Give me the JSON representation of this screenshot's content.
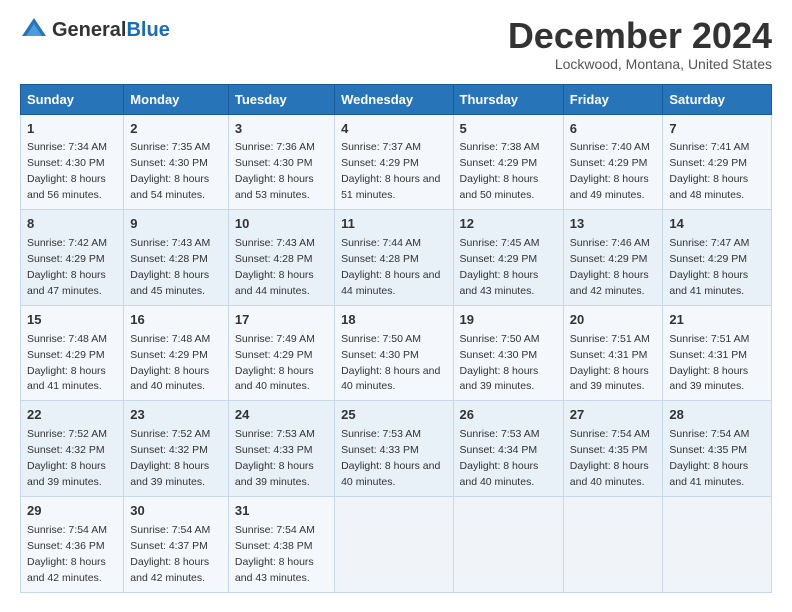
{
  "logo": {
    "general": "General",
    "blue": "Blue"
  },
  "title": "December 2024",
  "subtitle": "Lockwood, Montana, United States",
  "header": {
    "days": [
      "Sunday",
      "Monday",
      "Tuesday",
      "Wednesday",
      "Thursday",
      "Friday",
      "Saturday"
    ]
  },
  "weeks": [
    [
      {
        "day": "1",
        "sunrise": "7:34 AM",
        "sunset": "4:30 PM",
        "daylight": "8 hours and 56 minutes."
      },
      {
        "day": "2",
        "sunrise": "7:35 AM",
        "sunset": "4:30 PM",
        "daylight": "8 hours and 54 minutes."
      },
      {
        "day": "3",
        "sunrise": "7:36 AM",
        "sunset": "4:30 PM",
        "daylight": "8 hours and 53 minutes."
      },
      {
        "day": "4",
        "sunrise": "7:37 AM",
        "sunset": "4:29 PM",
        "daylight": "8 hours and 51 minutes."
      },
      {
        "day": "5",
        "sunrise": "7:38 AM",
        "sunset": "4:29 PM",
        "daylight": "8 hours and 50 minutes."
      },
      {
        "day": "6",
        "sunrise": "7:40 AM",
        "sunset": "4:29 PM",
        "daylight": "8 hours and 49 minutes."
      },
      {
        "day": "7",
        "sunrise": "7:41 AM",
        "sunset": "4:29 PM",
        "daylight": "8 hours and 48 minutes."
      }
    ],
    [
      {
        "day": "8",
        "sunrise": "7:42 AM",
        "sunset": "4:29 PM",
        "daylight": "8 hours and 47 minutes."
      },
      {
        "day": "9",
        "sunrise": "7:43 AM",
        "sunset": "4:28 PM",
        "daylight": "8 hours and 45 minutes."
      },
      {
        "day": "10",
        "sunrise": "7:43 AM",
        "sunset": "4:28 PM",
        "daylight": "8 hours and 44 minutes."
      },
      {
        "day": "11",
        "sunrise": "7:44 AM",
        "sunset": "4:28 PM",
        "daylight": "8 hours and 44 minutes."
      },
      {
        "day": "12",
        "sunrise": "7:45 AM",
        "sunset": "4:29 PM",
        "daylight": "8 hours and 43 minutes."
      },
      {
        "day": "13",
        "sunrise": "7:46 AM",
        "sunset": "4:29 PM",
        "daylight": "8 hours and 42 minutes."
      },
      {
        "day": "14",
        "sunrise": "7:47 AM",
        "sunset": "4:29 PM",
        "daylight": "8 hours and 41 minutes."
      }
    ],
    [
      {
        "day": "15",
        "sunrise": "7:48 AM",
        "sunset": "4:29 PM",
        "daylight": "8 hours and 41 minutes."
      },
      {
        "day": "16",
        "sunrise": "7:48 AM",
        "sunset": "4:29 PM",
        "daylight": "8 hours and 40 minutes."
      },
      {
        "day": "17",
        "sunrise": "7:49 AM",
        "sunset": "4:29 PM",
        "daylight": "8 hours and 40 minutes."
      },
      {
        "day": "18",
        "sunrise": "7:50 AM",
        "sunset": "4:30 PM",
        "daylight": "8 hours and 40 minutes."
      },
      {
        "day": "19",
        "sunrise": "7:50 AM",
        "sunset": "4:30 PM",
        "daylight": "8 hours and 39 minutes."
      },
      {
        "day": "20",
        "sunrise": "7:51 AM",
        "sunset": "4:31 PM",
        "daylight": "8 hours and 39 minutes."
      },
      {
        "day": "21",
        "sunrise": "7:51 AM",
        "sunset": "4:31 PM",
        "daylight": "8 hours and 39 minutes."
      }
    ],
    [
      {
        "day": "22",
        "sunrise": "7:52 AM",
        "sunset": "4:32 PM",
        "daylight": "8 hours and 39 minutes."
      },
      {
        "day": "23",
        "sunrise": "7:52 AM",
        "sunset": "4:32 PM",
        "daylight": "8 hours and 39 minutes."
      },
      {
        "day": "24",
        "sunrise": "7:53 AM",
        "sunset": "4:33 PM",
        "daylight": "8 hours and 39 minutes."
      },
      {
        "day": "25",
        "sunrise": "7:53 AM",
        "sunset": "4:33 PM",
        "daylight": "8 hours and 40 minutes."
      },
      {
        "day": "26",
        "sunrise": "7:53 AM",
        "sunset": "4:34 PM",
        "daylight": "8 hours and 40 minutes."
      },
      {
        "day": "27",
        "sunrise": "7:54 AM",
        "sunset": "4:35 PM",
        "daylight": "8 hours and 40 minutes."
      },
      {
        "day": "28",
        "sunrise": "7:54 AM",
        "sunset": "4:35 PM",
        "daylight": "8 hours and 41 minutes."
      }
    ],
    [
      {
        "day": "29",
        "sunrise": "7:54 AM",
        "sunset": "4:36 PM",
        "daylight": "8 hours and 42 minutes."
      },
      {
        "day": "30",
        "sunrise": "7:54 AM",
        "sunset": "4:37 PM",
        "daylight": "8 hours and 42 minutes."
      },
      {
        "day": "31",
        "sunrise": "7:54 AM",
        "sunset": "4:38 PM",
        "daylight": "8 hours and 43 minutes."
      },
      null,
      null,
      null,
      null
    ]
  ],
  "labels": {
    "sunrise": "Sunrise:",
    "sunset": "Sunset:",
    "daylight": "Daylight:"
  }
}
